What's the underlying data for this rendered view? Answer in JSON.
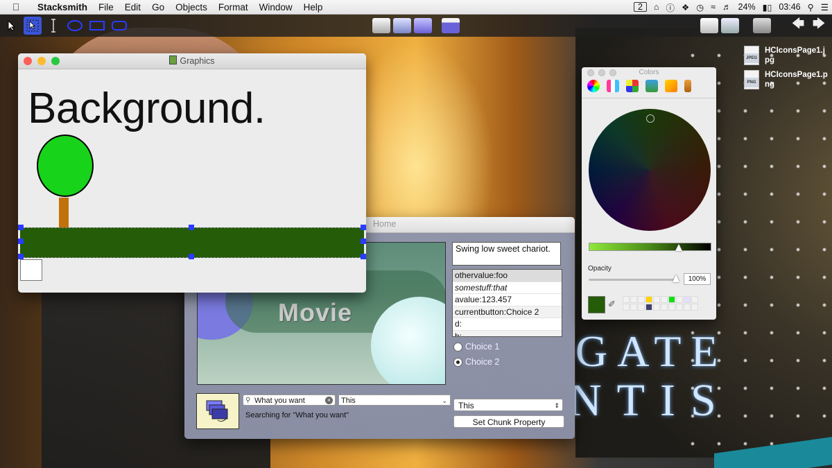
{
  "menubar": {
    "apple": "",
    "items": [
      "Stacksmith",
      "File",
      "Edit",
      "Go",
      "Objects",
      "Format",
      "Window",
      "Help"
    ],
    "status": {
      "badge_number": "2",
      "battery": "24%",
      "time": "03:46"
    }
  },
  "desktop": {
    "files": [
      {
        "name": "HCIconsPage1.jpg",
        "name_line1": "HCIconsPage1.j",
        "name_line2": "pg",
        "type": "JPEG"
      },
      {
        "name": "HCIconsPage1.png",
        "name_line1": "HCIconsPage1.p",
        "name_line2": "ng",
        "type": "PNG"
      }
    ],
    "logo_text_1": "GATE",
    "logo_text_2": "NTIS"
  },
  "graphics_window": {
    "title": "Graphics",
    "background_text": "Background.",
    "colors": {
      "tree": "#17d41a",
      "trunk": "#c3710a",
      "ground": "#245c07",
      "handles": "#2a3cff"
    }
  },
  "home_window": {
    "title": "Home",
    "movie_label": "Movie",
    "text_field": "Swing low sweet chariot.",
    "list_items": [
      {
        "text": "othervalue:foo",
        "italic": false
      },
      {
        "text": "somestuff:that",
        "italic": true
      },
      {
        "text": "avalue:123.457",
        "italic": false
      },
      {
        "text": "currentbutton:Choice 2",
        "italic": false
      },
      {
        "text": "d:",
        "italic": false
      },
      {
        "text": "b:",
        "italic": false
      }
    ],
    "radio_1": "Choice 1",
    "radio_2": "Choice 2",
    "selected_radio": "Choice 2",
    "search_value": "What you want",
    "combo_value": "This",
    "searching_text": "Searching for \"What you want\"",
    "popup_value": "This",
    "set_chunk_button": "Set Chunk Property"
  },
  "colors_panel": {
    "title": "Colors",
    "opacity_label": "Opacity",
    "opacity_value": "100%",
    "selected_color": "#245c07",
    "brightness_level": 0.74
  }
}
